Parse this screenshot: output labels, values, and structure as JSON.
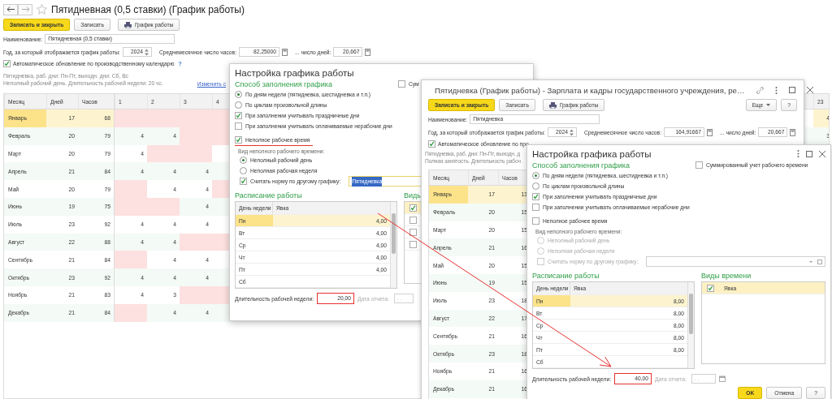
{
  "main": {
    "title": "Пятидневная (0,5 ставки) (График работы)",
    "buttons": [
      {
        "label": "Записать и закрыть",
        "kind": "primary"
      },
      {
        "label": "Записать",
        "kind": "plain"
      },
      {
        "label": "График работы",
        "kind": "print"
      }
    ],
    "name": {
      "label": "Наименование:",
      "value": "Пятидневная (0,5 ставки)"
    },
    "year": {
      "label": "Год, за который отображается график работы:",
      "value": "2024"
    },
    "avg_hours": {
      "label": "Среднемесячное число часов:",
      "value": "82,25000"
    },
    "avg_days": {
      "label": "... число дней:",
      "value": "20,667"
    },
    "auto_update": {
      "label": "Автоматическое обновление по производственному календарю",
      "checked": true,
      "help": "?"
    },
    "info": [
      "Пятидневка, раб. дни: Пн-Пт, выходн. дни: Сб, Вс",
      "Неполный рабочий день. Длительность рабочей недели: 20 чс."
    ],
    "change_link": "Изменить с",
    "table": {
      "columns": [
        "Месяц",
        "Дней",
        "Часов",
        "1",
        "2",
        "3",
        "4",
        "23"
      ],
      "rows": [
        {
          "month": "Январь",
          "days": "17",
          "hours": "68",
          "selected": true,
          "cells": [
            {
              "off": true
            },
            {
              "off": true
            },
            {
              "off": true
            },
            {
              "off": true
            },
            {
              "value": "4",
              "off": false
            }
          ]
        },
        {
          "month": "Февраль",
          "days": "20",
          "hours": "79",
          "selected": false,
          "cells": [
            {
              "value": "4",
              "off": false
            },
            {
              "value": "4",
              "off": false
            },
            {
              "off": true
            },
            {
              "off": true
            },
            {
              "value": "3",
              "off": false
            }
          ]
        },
        {
          "month": "Март",
          "days": "20",
          "hours": "79",
          "selected": false,
          "cells": [
            {
              "value": "4",
              "off": false
            },
            {
              "off": true
            },
            {
              "off": true
            }
          ]
        },
        {
          "month": "Апрель",
          "days": "21",
          "hours": "84",
          "selected": false,
          "cells": [
            {
              "value": "4",
              "off": false
            },
            {
              "value": "4",
              "off": false
            },
            {
              "value": "4",
              "off": false
            }
          ]
        },
        {
          "month": "Май",
          "days": "20",
          "hours": "79",
          "selected": false,
          "cells": [
            {
              "off": true
            },
            {
              "value": "4",
              "off": false
            },
            {
              "value": "4",
              "off": false
            },
            {
              "off": true
            }
          ]
        },
        {
          "month": "Июнь",
          "days": "19",
          "hours": "75",
          "selected": false,
          "cells": [
            {
              "off": true
            },
            {
              "off": true
            },
            {
              "value": "4",
              "off": false
            }
          ]
        },
        {
          "month": "Июль",
          "days": "23",
          "hours": "92",
          "selected": false,
          "cells": [
            {
              "value": "4",
              "off": false
            },
            {
              "value": "4",
              "off": false
            },
            {
              "value": "4",
              "off": false
            }
          ]
        },
        {
          "month": "Август",
          "days": "22",
          "hours": "88",
          "selected": false,
          "cells": [
            {
              "value": "4",
              "off": false
            },
            {
              "value": "4",
              "off": false
            },
            {
              "off": true
            },
            {
              "off": true
            }
          ]
        },
        {
          "month": "Сентябрь",
          "days": "21",
          "hours": "84",
          "selected": false,
          "cells": [
            {
              "off": true
            },
            {
              "value": "4",
              "off": false
            },
            {
              "value": "4",
              "off": false
            }
          ]
        },
        {
          "month": "Октябрь",
          "days": "23",
          "hours": "92",
          "selected": false,
          "cells": [
            {
              "value": "4",
              "off": false
            },
            {
              "value": "4",
              "off": false
            },
            {
              "value": "4",
              "off": false
            }
          ]
        },
        {
          "month": "Ноябрь",
          "days": "21",
          "hours": "83",
          "selected": false,
          "cells": [
            {
              "value": "4",
              "off": false
            },
            {
              "value": "3",
              "off": false
            },
            {
              "off": true
            },
            {
              "off": true
            }
          ]
        },
        {
          "month": "Декабрь",
          "days": "21",
          "hours": "84",
          "selected": false,
          "cells": [
            {
              "off": true
            },
            {
              "value": "4",
              "off": false
            },
            {
              "value": "4",
              "off": false
            }
          ]
        }
      ]
    }
  },
  "window2": {
    "title": "Пятидневка (График работы) - Зарплата и кадры государственного учреждения, ре…",
    "buttons": [
      {
        "label": "Записать и закрыть",
        "kind": "primary"
      },
      {
        "label": "Записать",
        "kind": "plain"
      },
      {
        "label": "График работы",
        "kind": "print"
      }
    ],
    "more": "Еще",
    "help": "?",
    "name": {
      "label": "Наименование:",
      "value": "Пятидневка"
    },
    "year": {
      "label": "Год, за который отображается график работы:",
      "value": "2024"
    },
    "avg_hours": {
      "label": "Среднемесячное число часов:",
      "value": "164,91667"
    },
    "avg_days": {
      "label": "... число дней:",
      "value": "20,667"
    },
    "auto_update": {
      "label": "Автоматическое обновление по про",
      "checked": true
    },
    "info": [
      "Пятидневка, раб. дни: Пн-Пт, выходн. д",
      "Полная занятость. Длительность рабоч"
    ],
    "table": {
      "columns": [
        "Месяц",
        "Дней",
        "Часов"
      ],
      "rows": [
        {
          "month": "Январь",
          "days": "17",
          "hours": "13",
          "selected": true
        },
        {
          "month": "Февраль",
          "days": "20",
          "hours": "15",
          "selected": false
        },
        {
          "month": "Март",
          "days": "20",
          "hours": "15",
          "selected": false
        },
        {
          "month": "Апрель",
          "days": "21",
          "hours": "16",
          "selected": false
        },
        {
          "month": "Май",
          "days": "20",
          "hours": "15",
          "selected": false
        },
        {
          "month": "Июнь",
          "days": "19",
          "hours": "15",
          "selected": false
        },
        {
          "month": "Июль",
          "days": "23",
          "hours": "18",
          "selected": false
        },
        {
          "month": "Август",
          "days": "22",
          "hours": "17",
          "selected": false
        },
        {
          "month": "Сентябрь",
          "days": "21",
          "hours": "16",
          "selected": false
        },
        {
          "month": "Октябрь",
          "days": "23",
          "hours": "18",
          "selected": false
        },
        {
          "month": "Ноябрь",
          "days": "21",
          "hours": "16",
          "selected": false
        },
        {
          "month": "Декабрь",
          "days": "21",
          "hours": "16",
          "selected": false
        }
      ]
    }
  },
  "dialogs": [
    {
      "title": "Настройка графика работы",
      "fill_header": "Способ заполнения графика",
      "summed": {
        "label": "Сум",
        "checked": false
      },
      "fill_modes": [
        {
          "label": "По дням недели (пятидневка, шестидневка и т.п.)",
          "selected": true
        },
        {
          "label": "По циклам произвольной длины",
          "selected": false
        }
      ],
      "options": [
        {
          "label": "При заполнении учитывать праздничные дни",
          "checked": true
        },
        {
          "label": "При заполнении учитывать оплачиваемые нерабочие дни",
          "checked": false
        }
      ],
      "part_time": {
        "label": "Неполное рабочее время",
        "checked": true,
        "highlighted": true
      },
      "part_kind_label": "Вид неполного рабочего времени:",
      "part_kinds": [
        {
          "label": "Неполный рабочий день",
          "selected": true
        },
        {
          "label": "Неполная рабочая неделя",
          "selected": false
        }
      ],
      "other_norm": {
        "label": "Считать норму по другому графику:",
        "checked": true,
        "value": "Пятидневка",
        "value_selected": true
      },
      "schedule_header": "Расписание работы",
      "schedule_columns": [
        "День недели",
        "Явка"
      ],
      "schedule": [
        {
          "day": "Пн",
          "hours": "4,00",
          "selected": true
        },
        {
          "day": "Вт",
          "hours": "4,00",
          "selected": false
        },
        {
          "day": "Ср",
          "hours": "4,00",
          "selected": false
        },
        {
          "day": "Чт",
          "hours": "4,00",
          "selected": false
        },
        {
          "day": "Пт",
          "hours": "4,00",
          "selected": false
        },
        {
          "day": "Сб",
          "selected": false
        }
      ],
      "kinds_header": "Виды",
      "kinds": [
        {
          "checked": true,
          "selected": true
        },
        {
          "checked": false,
          "selected": false
        },
        {
          "checked": false,
          "selected": false
        },
        {
          "checked": false,
          "selected": false
        }
      ],
      "week_length": {
        "label": "Длительность рабочей недели:",
        "value": "20,00",
        "highlighted": true
      },
      "report_date": {
        "label": "Дата отчета:",
        "placeholder": ". ."
      }
    },
    {
      "title": "Настройка графика работы",
      "window_controls": true,
      "fill_header": "Способ заполнения графика",
      "summed": {
        "label": "Суммированный учет рабочего времени",
        "checked": false
      },
      "fill_modes": [
        {
          "label": "По дням недели (пятидневка, шестидневка и т.п.)",
          "selected": true
        },
        {
          "label": "По циклам произвольной длины",
          "selected": false
        }
      ],
      "options": [
        {
          "label": "При заполнении учитывать праздничные дни",
          "checked": true
        },
        {
          "label": "При заполнении учитывать оплачиваемые нерабочие дни",
          "checked": false
        }
      ],
      "part_time": {
        "label": "Неполное рабочее время",
        "checked": false,
        "highlighted": false
      },
      "part_kind_label": "Вид неполного рабочего времени:",
      "part_kinds": [
        {
          "label": "Неполный рабочий день",
          "selected": false
        },
        {
          "label": "Неполная рабочая неделя",
          "selected": false
        }
      ],
      "other_norm": {
        "label": "Считать норму по другому графику:",
        "checked": false
      },
      "schedule_header": "Расписание работы",
      "schedule_columns": [
        "День недели",
        "Явка"
      ],
      "schedule": [
        {
          "day": "Пн",
          "hours": "8,00",
          "selected": true
        },
        {
          "day": "Вт",
          "hours": "8,00",
          "selected": false
        },
        {
          "day": "Ср",
          "hours": "8,00",
          "selected": false
        },
        {
          "day": "Чт",
          "hours": "8,00",
          "selected": false
        },
        {
          "day": "Пт",
          "hours": "8,00",
          "selected": false
        },
        {
          "day": "Сб",
          "selected": false
        }
      ],
      "kinds_header": "Виды времени",
      "kinds": [
        {
          "label": "Явка",
          "checked": true,
          "selected": true
        }
      ],
      "week_length": {
        "label": "Длительность рабочей недели:",
        "value": "40,00",
        "highlighted": true
      },
      "report_date": {
        "label": "Дата отчета:",
        "placeholder": ". ."
      },
      "buttons": [
        {
          "label": "OK",
          "kind": "primary"
        },
        {
          "label": "Отмена",
          "kind": "plain"
        },
        {
          "label": "?",
          "kind": "plain"
        }
      ]
    }
  ]
}
